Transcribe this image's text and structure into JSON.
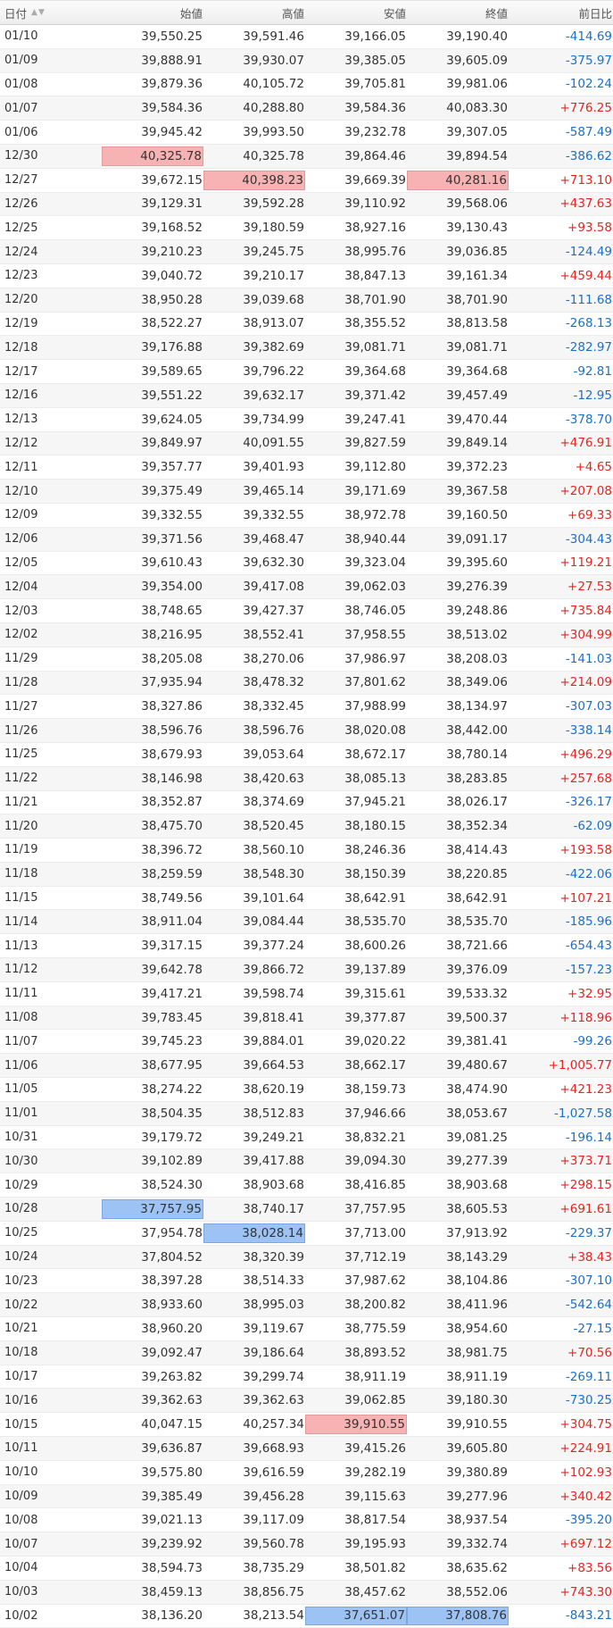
{
  "header": {
    "date": "日付",
    "open": "始値",
    "high": "高値",
    "low": "安値",
    "close": "終値",
    "change": "前日比",
    "sort_up_icon": "▲",
    "sort_down_icon": "▼"
  },
  "colors": {
    "positive": "#e8231d",
    "negative": "#1c6fc8",
    "highlight_red": "#f7b3b3",
    "highlight_blue": "#9cc3f3"
  },
  "rows": [
    {
      "date": "01/10",
      "open": "39,550.25",
      "high": "39,591.46",
      "low": "39,166.05",
      "close": "39,190.40",
      "change": "-414.69"
    },
    {
      "date": "01/09",
      "open": "39,888.91",
      "high": "39,930.07",
      "low": "39,385.05",
      "close": "39,605.09",
      "change": "-375.97"
    },
    {
      "date": "01/08",
      "open": "39,879.36",
      "high": "40,105.72",
      "low": "39,705.81",
      "close": "39,981.06",
      "change": "-102.24"
    },
    {
      "date": "01/07",
      "open": "39,584.36",
      "high": "40,288.80",
      "low": "39,584.36",
      "close": "40,083.30",
      "change": "+776.25"
    },
    {
      "date": "01/06",
      "open": "39,945.42",
      "high": "39,993.50",
      "low": "39,232.78",
      "close": "39,307.05",
      "change": "-587.49"
    },
    {
      "date": "12/30",
      "open": "40,325.78",
      "high": "40,325.78",
      "low": "39,864.46",
      "close": "39,894.54",
      "change": "-386.62",
      "hl": {
        "open": "red"
      }
    },
    {
      "date": "12/27",
      "open": "39,672.15",
      "high": "40,398.23",
      "low": "39,669.39",
      "close": "40,281.16",
      "change": "+713.10",
      "hl": {
        "high": "red",
        "close": "red"
      }
    },
    {
      "date": "12/26",
      "open": "39,129.31",
      "high": "39,592.28",
      "low": "39,110.92",
      "close": "39,568.06",
      "change": "+437.63"
    },
    {
      "date": "12/25",
      "open": "39,168.52",
      "high": "39,180.59",
      "low": "38,927.16",
      "close": "39,130.43",
      "change": "+93.58"
    },
    {
      "date": "12/24",
      "open": "39,210.23",
      "high": "39,245.75",
      "low": "38,995.76",
      "close": "39,036.85",
      "change": "-124.49"
    },
    {
      "date": "12/23",
      "open": "39,040.72",
      "high": "39,210.17",
      "low": "38,847.13",
      "close": "39,161.34",
      "change": "+459.44"
    },
    {
      "date": "12/20",
      "open": "38,950.28",
      "high": "39,039.68",
      "low": "38,701.90",
      "close": "38,701.90",
      "change": "-111.68"
    },
    {
      "date": "12/19",
      "open": "38,522.27",
      "high": "38,913.07",
      "low": "38,355.52",
      "close": "38,813.58",
      "change": "-268.13"
    },
    {
      "date": "12/18",
      "open": "39,176.88",
      "high": "39,382.69",
      "low": "39,081.71",
      "close": "39,081.71",
      "change": "-282.97"
    },
    {
      "date": "12/17",
      "open": "39,589.65",
      "high": "39,796.22",
      "low": "39,364.68",
      "close": "39,364.68",
      "change": "-92.81"
    },
    {
      "date": "12/16",
      "open": "39,551.22",
      "high": "39,632.17",
      "low": "39,371.42",
      "close": "39,457.49",
      "change": "-12.95"
    },
    {
      "date": "12/13",
      "open": "39,624.05",
      "high": "39,734.99",
      "low": "39,247.41",
      "close": "39,470.44",
      "change": "-378.70"
    },
    {
      "date": "12/12",
      "open": "39,849.97",
      "high": "40,091.55",
      "low": "39,827.59",
      "close": "39,849.14",
      "change": "+476.91"
    },
    {
      "date": "12/11",
      "open": "39,357.77",
      "high": "39,401.93",
      "low": "39,112.80",
      "close": "39,372.23",
      "change": "+4.65"
    },
    {
      "date": "12/10",
      "open": "39,375.49",
      "high": "39,465.14",
      "low": "39,171.69",
      "close": "39,367.58",
      "change": "+207.08"
    },
    {
      "date": "12/09",
      "open": "39,332.55",
      "high": "39,332.55",
      "low": "38,972.78",
      "close": "39,160.50",
      "change": "+69.33"
    },
    {
      "date": "12/06",
      "open": "39,371.56",
      "high": "39,468.47",
      "low": "38,940.44",
      "close": "39,091.17",
      "change": "-304.43"
    },
    {
      "date": "12/05",
      "open": "39,610.43",
      "high": "39,632.30",
      "low": "39,323.04",
      "close": "39,395.60",
      "change": "+119.21"
    },
    {
      "date": "12/04",
      "open": "39,354.00",
      "high": "39,417.08",
      "low": "39,062.03",
      "close": "39,276.39",
      "change": "+27.53"
    },
    {
      "date": "12/03",
      "open": "38,748.65",
      "high": "39,427.37",
      "low": "38,746.05",
      "close": "39,248.86",
      "change": "+735.84"
    },
    {
      "date": "12/02",
      "open": "38,216.95",
      "high": "38,552.41",
      "low": "37,958.55",
      "close": "38,513.02",
      "change": "+304.99"
    },
    {
      "date": "11/29",
      "open": "38,205.08",
      "high": "38,270.06",
      "low": "37,986.97",
      "close": "38,208.03",
      "change": "-141.03"
    },
    {
      "date": "11/28",
      "open": "37,935.94",
      "high": "38,478.32",
      "low": "37,801.62",
      "close": "38,349.06",
      "change": "+214.09"
    },
    {
      "date": "11/27",
      "open": "38,327.86",
      "high": "38,332.45",
      "low": "37,988.99",
      "close": "38,134.97",
      "change": "-307.03"
    },
    {
      "date": "11/26",
      "open": "38,596.76",
      "high": "38,596.76",
      "low": "38,020.08",
      "close": "38,442.00",
      "change": "-338.14"
    },
    {
      "date": "11/25",
      "open": "38,679.93",
      "high": "39,053.64",
      "low": "38,672.17",
      "close": "38,780.14",
      "change": "+496.29"
    },
    {
      "date": "11/22",
      "open": "38,146.98",
      "high": "38,420.63",
      "low": "38,085.13",
      "close": "38,283.85",
      "change": "+257.68"
    },
    {
      "date": "11/21",
      "open": "38,352.87",
      "high": "38,374.69",
      "low": "37,945.21",
      "close": "38,026.17",
      "change": "-326.17"
    },
    {
      "date": "11/20",
      "open": "38,475.70",
      "high": "38,520.45",
      "low": "38,180.15",
      "close": "38,352.34",
      "change": "-62.09"
    },
    {
      "date": "11/19",
      "open": "38,396.72",
      "high": "38,560.10",
      "low": "38,246.36",
      "close": "38,414.43",
      "change": "+193.58"
    },
    {
      "date": "11/18",
      "open": "38,259.59",
      "high": "38,548.30",
      "low": "38,150.39",
      "close": "38,220.85",
      "change": "-422.06"
    },
    {
      "date": "11/15",
      "open": "38,749.56",
      "high": "39,101.64",
      "low": "38,642.91",
      "close": "38,642.91",
      "change": "+107.21"
    },
    {
      "date": "11/14",
      "open": "38,911.04",
      "high": "39,084.44",
      "low": "38,535.70",
      "close": "38,535.70",
      "change": "-185.96"
    },
    {
      "date": "11/13",
      "open": "39,317.15",
      "high": "39,377.24",
      "low": "38,600.26",
      "close": "38,721.66",
      "change": "-654.43"
    },
    {
      "date": "11/12",
      "open": "39,642.78",
      "high": "39,866.72",
      "low": "39,137.89",
      "close": "39,376.09",
      "change": "-157.23"
    },
    {
      "date": "11/11",
      "open": "39,417.21",
      "high": "39,598.74",
      "low": "39,315.61",
      "close": "39,533.32",
      "change": "+32.95"
    },
    {
      "date": "11/08",
      "open": "39,783.45",
      "high": "39,818.41",
      "low": "39,377.87",
      "close": "39,500.37",
      "change": "+118.96"
    },
    {
      "date": "11/07",
      "open": "39,745.23",
      "high": "39,884.01",
      "low": "39,020.22",
      "close": "39,381.41",
      "change": "-99.26"
    },
    {
      "date": "11/06",
      "open": "38,677.95",
      "high": "39,664.53",
      "low": "38,662.17",
      "close": "39,480.67",
      "change": "+1,005.77"
    },
    {
      "date": "11/05",
      "open": "38,274.22",
      "high": "38,620.19",
      "low": "38,159.73",
      "close": "38,474.90",
      "change": "+421.23"
    },
    {
      "date": "11/01",
      "open": "38,504.35",
      "high": "38,512.83",
      "low": "37,946.66",
      "close": "38,053.67",
      "change": "-1,027.58"
    },
    {
      "date": "10/31",
      "open": "39,179.72",
      "high": "39,249.21",
      "low": "38,832.21",
      "close": "39,081.25",
      "change": "-196.14"
    },
    {
      "date": "10/30",
      "open": "39,102.89",
      "high": "39,417.88",
      "low": "39,094.30",
      "close": "39,277.39",
      "change": "+373.71"
    },
    {
      "date": "10/29",
      "open": "38,524.30",
      "high": "38,903.68",
      "low": "38,416.85",
      "close": "38,903.68",
      "change": "+298.15"
    },
    {
      "date": "10/28",
      "open": "37,757.95",
      "high": "38,740.17",
      "low": "37,757.95",
      "close": "38,605.53",
      "change": "+691.61",
      "hl": {
        "open": "blue"
      }
    },
    {
      "date": "10/25",
      "open": "37,954.78",
      "high": "38,028.14",
      "low": "37,713.00",
      "close": "37,913.92",
      "change": "-229.37",
      "hl": {
        "high": "blue"
      }
    },
    {
      "date": "10/24",
      "open": "37,804.52",
      "high": "38,320.39",
      "low": "37,712.19",
      "close": "38,143.29",
      "change": "+38.43"
    },
    {
      "date": "10/23",
      "open": "38,397.28",
      "high": "38,514.33",
      "low": "37,987.62",
      "close": "38,104.86",
      "change": "-307.10"
    },
    {
      "date": "10/22",
      "open": "38,933.60",
      "high": "38,995.03",
      "low": "38,200.82",
      "close": "38,411.96",
      "change": "-542.64"
    },
    {
      "date": "10/21",
      "open": "38,960.20",
      "high": "39,119.67",
      "low": "38,775.59",
      "close": "38,954.60",
      "change": "-27.15"
    },
    {
      "date": "10/18",
      "open": "39,092.47",
      "high": "39,186.64",
      "low": "38,893.52",
      "close": "38,981.75",
      "change": "+70.56"
    },
    {
      "date": "10/17",
      "open": "39,263.82",
      "high": "39,299.74",
      "low": "38,911.19",
      "close": "38,911.19",
      "change": "-269.11"
    },
    {
      "date": "10/16",
      "open": "39,362.63",
      "high": "39,362.63",
      "low": "39,062.85",
      "close": "39,180.30",
      "change": "-730.25"
    },
    {
      "date": "10/15",
      "open": "40,047.15",
      "high": "40,257.34",
      "low": "39,910.55",
      "close": "39,910.55",
      "change": "+304.75",
      "hl": {
        "low": "red"
      }
    },
    {
      "date": "10/11",
      "open": "39,636.87",
      "high": "39,668.93",
      "low": "39,415.26",
      "close": "39,605.80",
      "change": "+224.91"
    },
    {
      "date": "10/10",
      "open": "39,575.80",
      "high": "39,616.59",
      "low": "39,282.19",
      "close": "39,380.89",
      "change": "+102.93"
    },
    {
      "date": "10/09",
      "open": "39,385.49",
      "high": "39,456.28",
      "low": "39,115.63",
      "close": "39,277.96",
      "change": "+340.42"
    },
    {
      "date": "10/08",
      "open": "39,021.13",
      "high": "39,117.09",
      "low": "38,817.54",
      "close": "38,937.54",
      "change": "-395.20"
    },
    {
      "date": "10/07",
      "open": "39,239.92",
      "high": "39,560.78",
      "low": "39,195.93",
      "close": "39,332.74",
      "change": "+697.12"
    },
    {
      "date": "10/04",
      "open": "38,594.73",
      "high": "38,735.29",
      "low": "38,501.82",
      "close": "38,635.62",
      "change": "+83.56"
    },
    {
      "date": "10/03",
      "open": "38,459.13",
      "high": "38,856.75",
      "low": "38,457.62",
      "close": "38,552.06",
      "change": "+743.30"
    },
    {
      "date": "10/02",
      "open": "38,136.20",
      "high": "38,213.54",
      "low": "37,651.07",
      "close": "37,808.76",
      "change": "-843.21",
      "hl": {
        "low": "blue",
        "close": "blue"
      }
    }
  ]
}
